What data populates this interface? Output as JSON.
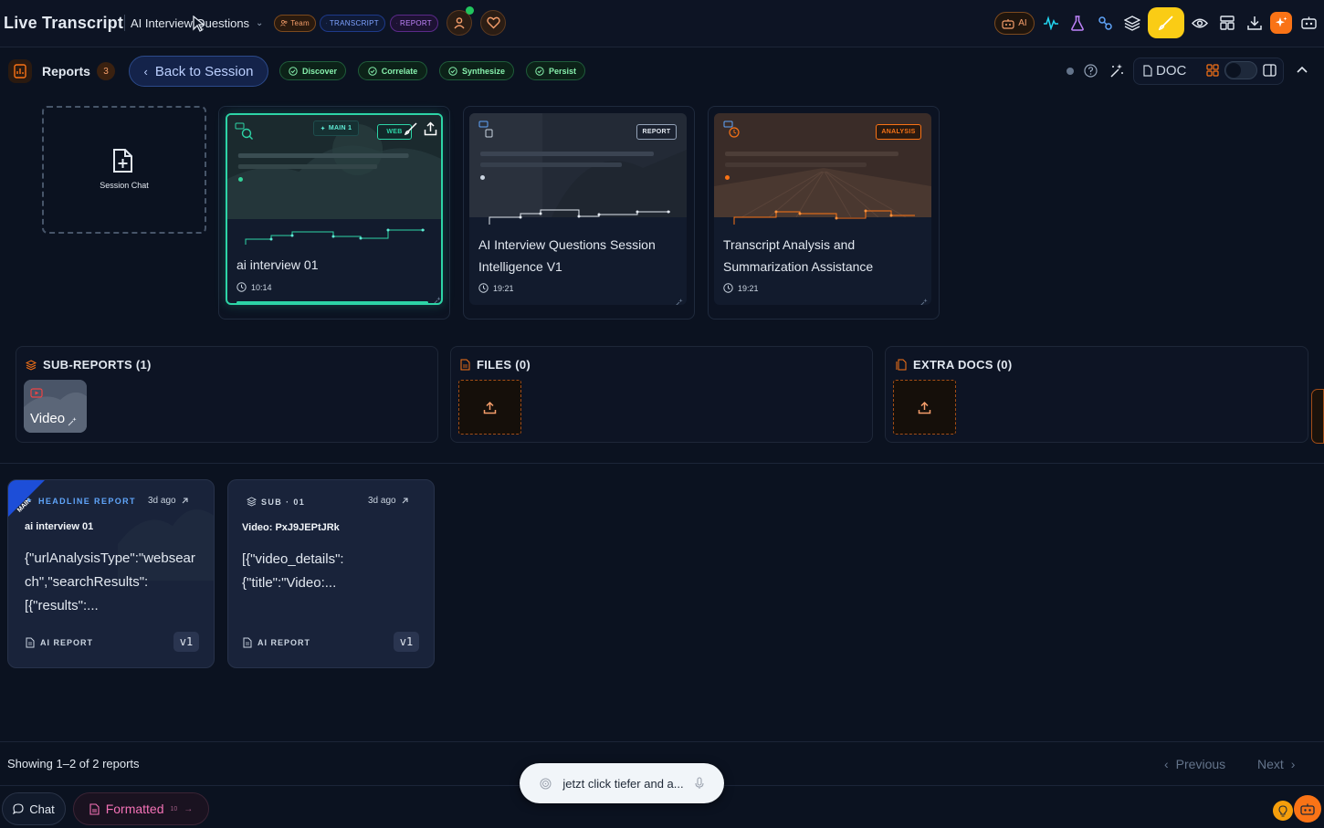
{
  "header": {
    "app_title": "Live Transcript",
    "session_title": "AI Interview Questions",
    "pills": {
      "team": "Team",
      "transcript": "TRANSCRIPT",
      "report": "REPORT"
    },
    "ai_label": "AI"
  },
  "toolbar": {
    "reports_label": "Reports",
    "reports_count": "3",
    "back_label": "Back to Session",
    "steps": [
      "Discover",
      "Correlate",
      "Synthesize",
      "Persist"
    ],
    "doc_label": "DOC"
  },
  "sessions": {
    "chat_label": "Session Chat",
    "cards": [
      {
        "title": "ai interview 01",
        "time": "10:14",
        "tags": [
          "MAIN 1",
          "WEB"
        ]
      },
      {
        "title": "AI Interview Questions Session Intelligence V1",
        "time": "19:21",
        "tag": "REPORT"
      },
      {
        "title": "Transcript Analysis and Summarization Assistance",
        "time": "19:21",
        "tag": "ANALYSIS"
      }
    ]
  },
  "panels": {
    "subreports_title": "SUB-REPORTS (1)",
    "subreport_item": "Video",
    "files_title": "FILES (0)",
    "extra_title": "EXTRA DOCS (0)"
  },
  "reports": [
    {
      "corner": "MAIN",
      "label": "HEADLINE REPORT",
      "ago": "3d ago",
      "title": "ai interview 01",
      "body_lines": [
        "{\"urlAnalysisType\":\"websear",
        "ch\",\"searchResults\":",
        "[{\"results\":..."
      ],
      "foot": "AI REPORT",
      "version": "v1"
    },
    {
      "label": "SUB · 01",
      "ago": "3d ago",
      "title": "Video: PxJ9JEPtJRk",
      "body_lines": [
        "[{\"video_details\":",
        "{\"title\":\"Video:..."
      ],
      "foot": "AI REPORT",
      "version": "v1"
    }
  ],
  "footer": {
    "showing": "Showing 1–2 of 2 reports",
    "previous": "Previous",
    "next": "Next",
    "chat": "Chat",
    "formatted": "Formatted",
    "formatted_badge": "10",
    "voice_text": "jetzt click tiefer and a..."
  },
  "colors": {
    "accent_teal": "#2dd4a6",
    "accent_orange": "#f97316",
    "accent_yellow": "#facc15",
    "accent_blue": "#3b82f6"
  }
}
